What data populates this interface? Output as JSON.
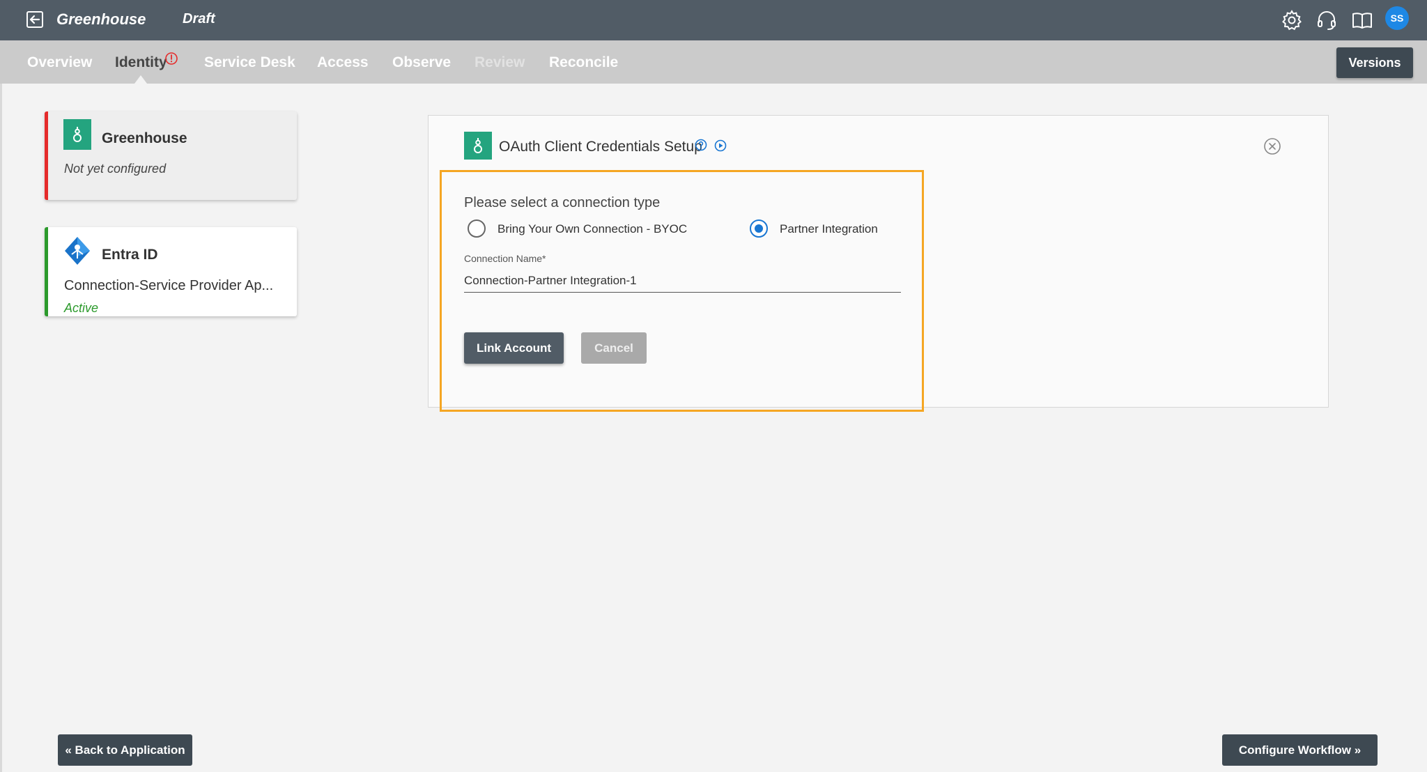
{
  "header": {
    "app_title": "Greenhouse",
    "status": "Draft",
    "avatar_initials": "SS",
    "icons": [
      "exit-icon",
      "gear-icon",
      "headset-icon",
      "book-icon"
    ]
  },
  "nav": {
    "tabs": [
      {
        "label": "Overview",
        "state": "normal"
      },
      {
        "label": "Identity",
        "state": "active",
        "alert": true
      },
      {
        "label": "Service Desk",
        "state": "normal"
      },
      {
        "label": "Access",
        "state": "normal"
      },
      {
        "label": "Observe",
        "state": "normal"
      },
      {
        "label": "Review",
        "state": "disabled"
      },
      {
        "label": "Reconcile",
        "state": "normal"
      }
    ],
    "versions_label": "Versions"
  },
  "connectors": [
    {
      "name": "Greenhouse",
      "status": "Not yet configured",
      "indicator_color": "#e52b2b",
      "icon": "greenhouse-logo-icon"
    },
    {
      "name": "Entra ID",
      "connection": "Connection-Service Provider Ap...",
      "status": "Active",
      "indicator_color": "#2c9a2c",
      "icon": "entra-id-logo-icon"
    }
  ],
  "panel": {
    "title": "OAuth Client Credentials Setup",
    "form": {
      "heading": "Please select a connection type",
      "options": [
        {
          "label": "Bring Your Own Connection - BYOC",
          "selected": false
        },
        {
          "label": "Partner Integration",
          "selected": true
        }
      ],
      "connection_name_label": "Connection Name*",
      "connection_name_value": "Connection-Partner Integration-1",
      "link_label": "Link Account",
      "cancel_label": "Cancel"
    }
  },
  "footer": {
    "back_label": "« Back to Application",
    "configure_label": "Configure Workflow »"
  },
  "colors": {
    "topbar": "#515c66",
    "navbar": "#cbcbcb",
    "brand_green": "#24a47f",
    "highlight": "#f5a623",
    "radio_selected": "#1976d2"
  }
}
